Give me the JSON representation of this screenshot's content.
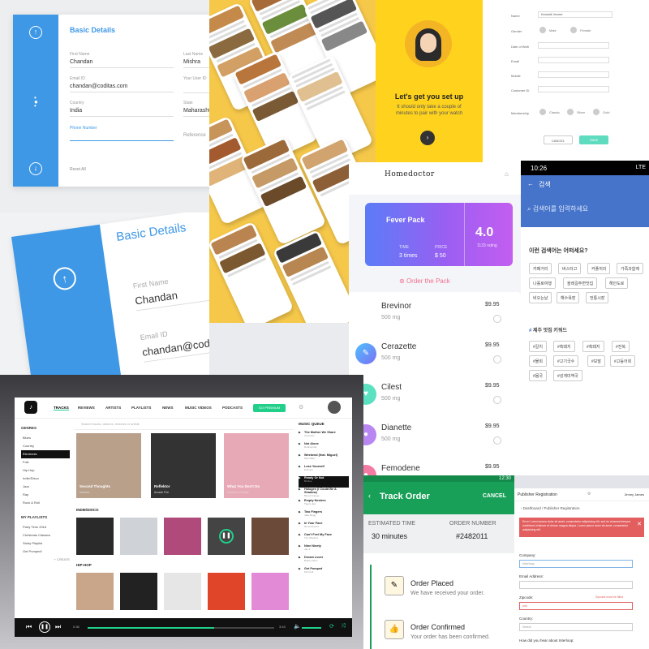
{
  "colors": {
    "blue": "#3e98e6",
    "yellow_bg": "#f6c84a",
    "setup_bg": "#ffd31d",
    "korean_header": "#4674ca",
    "fever_gradient_start": "#5b7cf7",
    "fever_gradient_end": "#c35ef0",
    "music_accent": "#1fcf8a",
    "order_green": "#18a058",
    "error_red": "#e35e5e"
  },
  "basic_details": {
    "title": "Basic Details",
    "first_name_label": "First Name",
    "first_name": "Chandan",
    "last_name_label": "Last Name",
    "last_name": "Mishra",
    "email_label": "Email ID",
    "email": "chandan@coditas.com",
    "user_id_label": "Your User ID",
    "user_id": "",
    "country_label": "Country",
    "country": "India",
    "state_label": "State",
    "state": "Maharashtra",
    "phone_label": "Phone Number",
    "phone": "",
    "reference_label": "Reference",
    "reset": "Reset All",
    "icons": [
      "arrow-up-icon",
      "arrow-down-icon"
    ]
  },
  "setup": {
    "title": "Let's get you set up",
    "subtitle": "It should only take a couple of minutes to pair with your watch",
    "next_icon": "chevron-right-icon"
  },
  "customer_form": {
    "labels": [
      "Name",
      "Gender",
      "Date of Birth",
      "Email",
      "Mobile",
      "Customer ID",
      "Membership"
    ],
    "name_value": "Kendall Jenner",
    "gender_options": [
      "Male",
      "Female"
    ],
    "membership_options": [
      "Classic",
      "Silver",
      "Gold"
    ],
    "cancel": "CANCEL",
    "save": "SAVE"
  },
  "korean_search": {
    "time": "10:26",
    "signal": "LTE",
    "title": "검색",
    "placeholder": "검색어를 입력하세요",
    "question": "이런 검색어는 어떠세요?",
    "suggestions": [
      "카페거리",
      "버스타고",
      "커플끼리",
      "가족과함께",
      "나홀로여행",
      "올레길주변맛집",
      "해안도로",
      "비오는날",
      "해수욕장",
      "전통시장"
    ],
    "keywords_title": "제주 맛집 키워드",
    "keywords": [
      "#갈치",
      "#흑돼지",
      "#흑돼지",
      "#전복",
      "#물회",
      "#고기국수",
      "#보말",
      "#고등어회",
      "#몸국",
      "#성게미역국"
    ]
  },
  "homedoctor": {
    "brand": "Homedoctor",
    "pack_name": "Fever Pack",
    "time_label": "TIME",
    "time_value": "3 times",
    "price_label": "PRICE",
    "price_value": "$ 50",
    "rating": "4.0",
    "rating_label": "1133 rating",
    "order_cta": "Order the Pack",
    "medicines": [
      {
        "name": "Brevinor",
        "dose": "500 mg",
        "price": "$9.95",
        "color": "#ffffff",
        "icon": "pill-icon"
      },
      {
        "name": "Cerazette",
        "dose": "500 mg",
        "price": "$9.95",
        "color": "#3cc3a8",
        "icon": "capsule-icon"
      },
      {
        "name": "Cilest",
        "dose": "500 mg",
        "price": "$9.95",
        "color": "#5be0c0",
        "icon": "heart-icon"
      },
      {
        "name": "Dianette",
        "dose": "500 mg",
        "price": "$9.95",
        "color": "#b887f2",
        "icon": "drop-icon"
      },
      {
        "name": "Femodene",
        "dose": "",
        "price": "$9.95",
        "color": "#f27aa3",
        "icon": "pill-icon"
      }
    ]
  },
  "music": {
    "nav": [
      "TRACKS",
      "REVIEWS",
      "ARTISTS",
      "PLAYLISTS",
      "NEWS",
      "MUSIC VIDEOS",
      "PODCASTS"
    ],
    "premium": "GO PREMIUM",
    "search_placeholder": "Search tracks, albums, reviews or artists",
    "genres_title": "GENRES",
    "genres": [
      "Blues",
      "Country",
      "Electronic",
      "Folk",
      "Hip Hop",
      "Indie/Disco",
      "Jazz",
      "Rap",
      "Rock & Roll"
    ],
    "selected_genre": "Electronic",
    "playlists_title": "MY PLAYLISTS",
    "playlists": [
      "Party Time 2016",
      "Christmas Classics",
      "Study Playlist",
      "Get Pumped!"
    ],
    "create": "+ CREATE",
    "featured": [
      {
        "title": "Second Thoughts",
        "artist": "Daniela",
        "color": "#b9a08a"
      },
      {
        "title": "Reflektor",
        "artist": "Arcade Fire",
        "color": "#333333"
      },
      {
        "title": "What You Don't Do",
        "artist": "Lianne La Havas",
        "color": "#e8a9b6"
      }
    ],
    "section_indie": "INDIE/DISCO",
    "section_hiphop": "HIP-HOP",
    "queue_title": "MUSIC QUEUE",
    "queue": [
      {
        "title": "The Mother We Share",
        "artist": "Chvrches"
      },
      {
        "title": "Not Alone",
        "artist": "Rudimental"
      },
      {
        "title": "Weekend (feat. Miguel)",
        "artist": "Mac Miller"
      },
      {
        "title": "Lose Yourself",
        "artist": "Eminem"
      },
      {
        "title": "Ready Or Not",
        "artist": "Bii Roe"
      },
      {
        "title": "Halogen (I Could Be A Shadow)",
        "artist": "Blood Orange"
      },
      {
        "title": "Empty Nesters",
        "artist": "Tigers Jaw"
      },
      {
        "title": "Two Fingers",
        "artist": "Jake Bugg"
      },
      {
        "title": "In Your Face",
        "artist": "Die Antwoord"
      },
      {
        "title": "Can't Feel My Face",
        "artist": "The Weeknd"
      },
      {
        "title": "Nine Ninety",
        "artist": "Jay Z"
      },
      {
        "title": "Dream Lover",
        "artist": "Bobby Darin"
      },
      {
        "title": "Get Pumped",
        "artist": "Kid Cudi"
      }
    ],
    "time_elapsed": "0:36",
    "time_total": "3:43"
  },
  "track_order": {
    "status_time": "12:30",
    "title": "Track Order",
    "cancel": "CANCEL",
    "eta_label": "ESTIMATED TIME",
    "eta_value": "30 minutes",
    "order_label": "ORDER NUMBER",
    "order_value": "#2482011",
    "steps": [
      {
        "title": "Order Placed",
        "desc": "We have received your order."
      },
      {
        "title": "Order Confirmed",
        "desc": "Your order has been confirmed."
      }
    ]
  },
  "publisher": {
    "title": "Publisher Registration",
    "user": "Jimmy James",
    "breadcrumb": "Dashboard / Publisher Registration",
    "error": "Error! Lorem ipsum dolor sit amet, consectetur adipisicing elit, sed do eiusmod tempor incididunt ut labore et dolore magna aliqua. Lorem ipsum dolor sit amet, consectetur adipisicing elit.",
    "company_label": "Company:",
    "company_value": "Interloop",
    "email_label": "Email Address:",
    "zip_label": "Zipcode:",
    "zip_value": "null",
    "zip_error": "Zipcode must be filled",
    "country_label": "Country:",
    "country_value": "Select",
    "hear_label": "How did you hear about Interloop:"
  }
}
